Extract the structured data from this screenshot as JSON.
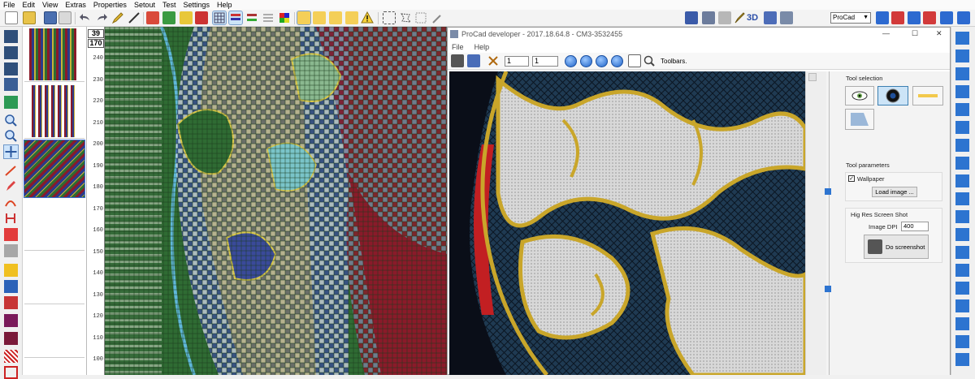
{
  "menu": [
    "File",
    "Edit",
    "View",
    "Extras",
    "Properties",
    "Setout",
    "Test",
    "Settings",
    "Help"
  ],
  "toolbar": {
    "profile_select": "ProCad",
    "label_3d": "3D"
  },
  "ruler": {
    "header_top": "39",
    "header_bottom": "170",
    "labels": [
      "240",
      "230",
      "220",
      "210",
      "200",
      "190",
      "180",
      "170",
      "160",
      "150",
      "140",
      "130",
      "120",
      "110",
      "100"
    ]
  },
  "sim_window": {
    "title": "ProCad developer - 2017.18.64.8 - CM3-3532455",
    "menu": [
      "File",
      "Help"
    ],
    "spin_left": "1",
    "spin_right": "1",
    "toolbars_label": "Toolbars.",
    "window_controls": {
      "minimize": "—",
      "maximize": "☐",
      "close": "✕"
    }
  },
  "panel": {
    "tool_selection": "Tool selection",
    "tool_parameters": "Tool parameters",
    "wallpaper_label": "Wallpaper",
    "wallpaper_checked": true,
    "load_image": "Load image ...",
    "hires_title": "Hig Res Screen Shot",
    "dpi_label": "Image DPI",
    "dpi_value": "400",
    "do_screenshot": "Do screenshot"
  },
  "colors": {
    "design_green": "#2f6b33",
    "lace_gold": "#c9a62a",
    "lace_white": "#d8d8d8",
    "net_blue": "#1f3a52",
    "edge_red": "#c21f22"
  }
}
